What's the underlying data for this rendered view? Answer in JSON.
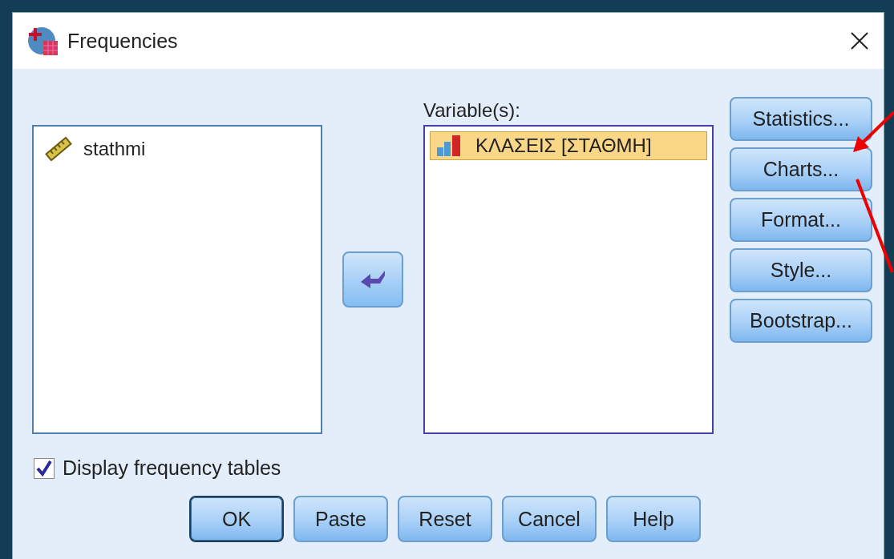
{
  "window": {
    "title": "Frequencies"
  },
  "source_list": {
    "items": [
      {
        "name": "stathmi",
        "kind": "scale",
        "selected": false
      }
    ]
  },
  "variables_label": "Variable(s):",
  "variables_list": {
    "items": [
      {
        "name": "ΚΛΑΣΕΙΣ [ΣΤΑΘΜΗ]",
        "kind": "ordinal",
        "selected": true
      }
    ]
  },
  "side_buttons": [
    "Statistics...",
    "Charts...",
    "Format...",
    "Style...",
    "Bootstrap..."
  ],
  "display_frequency_tables": {
    "label": "Display frequency tables",
    "checked": true
  },
  "buttons": [
    {
      "label": "OK",
      "default": true
    },
    {
      "label": "Paste",
      "default": false
    },
    {
      "label": "Reset",
      "default": false
    },
    {
      "label": "Cancel",
      "default": false
    },
    {
      "label": "Help",
      "default": false
    }
  ]
}
